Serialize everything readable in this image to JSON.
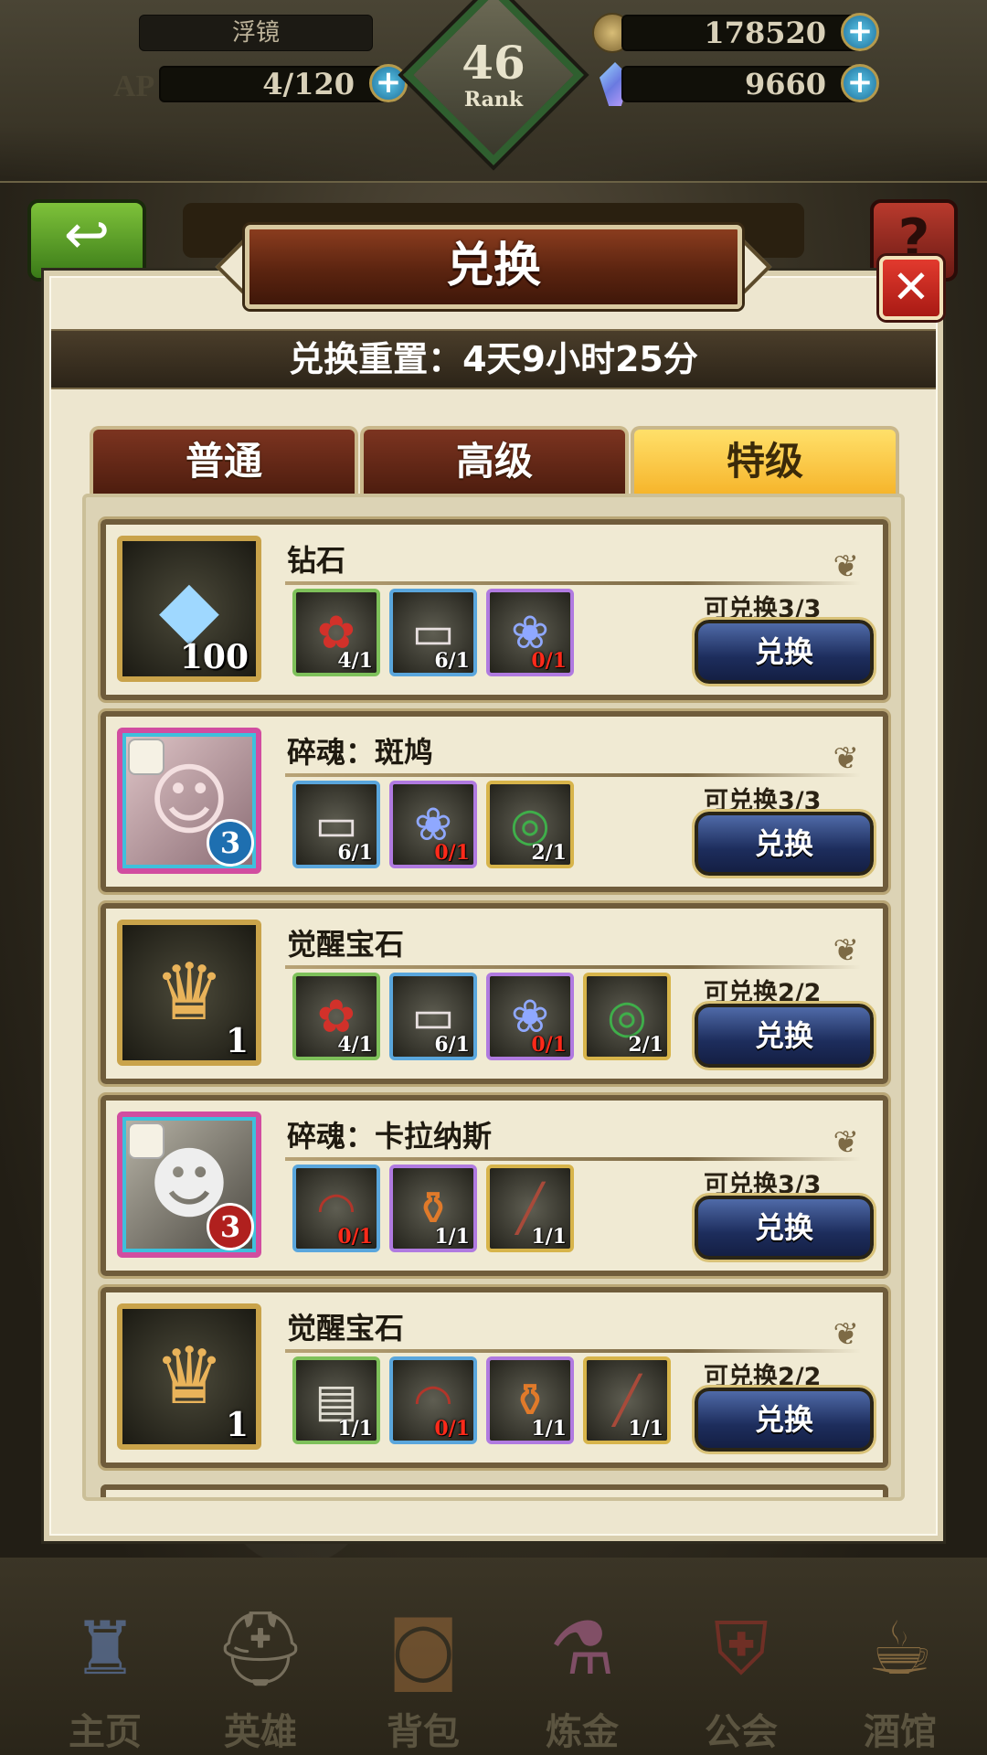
{
  "hud": {
    "player_name": "浮镜",
    "ap_label": "AP",
    "ap_value": "4/120",
    "rank_number": "46",
    "rank_label": "Rank",
    "gold": "178520",
    "gems": "9660",
    "plus_symbol": "+"
  },
  "dialog": {
    "title": "兑换",
    "close_symbol": "✕",
    "reset_text": "兑换重置：4天9小时25分",
    "tabs": [
      {
        "label": "普通",
        "active": false
      },
      {
        "label": "高级",
        "active": false
      },
      {
        "label": "特级",
        "active": true
      }
    ]
  },
  "rows": [
    {
      "name": "钻石",
      "reward_icon": "diamond-crystal-icon",
      "reward_qty": "100",
      "materials": [
        {
          "icon": "rose-bouquet-icon",
          "count": "4/1",
          "rarity": "green",
          "short": false
        },
        {
          "icon": "school-ticket-icon",
          "count": "6/1",
          "rarity": "blue",
          "short": false
        },
        {
          "icon": "blue-rose-icon",
          "count": "0/1",
          "rarity": "purple",
          "short": true
        }
      ],
      "available": "可兑换3/3",
      "button": "兑换"
    },
    {
      "name": "碎魂：斑鸠",
      "reward_icon": "hero-portrait-banjiu",
      "reward_badge": "3",
      "materials": [
        {
          "icon": "school-ticket-icon",
          "count": "6/1",
          "rarity": "blue",
          "short": false
        },
        {
          "icon": "blue-rose-icon",
          "count": "0/1",
          "rarity": "purple",
          "short": true
        },
        {
          "icon": "green-goggles-icon",
          "count": "2/1",
          "rarity": "gold",
          "short": false
        }
      ],
      "available": "可兑换3/3",
      "button": "兑换"
    },
    {
      "name": "觉醒宝石",
      "reward_icon": "awakening-gem-icon",
      "reward_qty": "1",
      "materials": [
        {
          "icon": "rose-bouquet-icon",
          "count": "4/1",
          "rarity": "green",
          "short": false
        },
        {
          "icon": "school-ticket-icon",
          "count": "6/1",
          "rarity": "blue",
          "short": false
        },
        {
          "icon": "blue-rose-icon",
          "count": "0/1",
          "rarity": "purple",
          "short": true
        },
        {
          "icon": "green-goggles-icon",
          "count": "2/1",
          "rarity": "gold",
          "short": false
        }
      ],
      "available": "可兑换2/2",
      "button": "兑换"
    },
    {
      "name": "碎魂：卡拉纳斯",
      "reward_icon": "hero-portrait-kalanasi",
      "reward_badge": "3",
      "materials": [
        {
          "icon": "red-mask-icon",
          "count": "0/1",
          "rarity": "blue",
          "short": true
        },
        {
          "icon": "potion-bottle-icon",
          "count": "1/1",
          "rarity": "purple",
          "short": false
        },
        {
          "icon": "flintlock-gun-icon",
          "count": "1/1",
          "rarity": "gold",
          "short": false
        }
      ],
      "available": "可兑换3/3",
      "button": "兑换"
    },
    {
      "name": "觉醒宝石",
      "reward_icon": "awakening-gem-icon",
      "reward_qty": "1",
      "materials": [
        {
          "icon": "newspaper-icon",
          "count": "1/1",
          "rarity": "green",
          "short": false
        },
        {
          "icon": "red-mask-icon",
          "count": "0/1",
          "rarity": "blue",
          "short": true
        },
        {
          "icon": "potion-bottle-icon",
          "count": "1/1",
          "rarity": "purple",
          "short": false
        },
        {
          "icon": "flintlock-gun-icon",
          "count": "1/1",
          "rarity": "gold",
          "short": false
        }
      ],
      "available": "可兑换2/2",
      "button": "兑换"
    }
  ],
  "nav": [
    {
      "label": "主页",
      "icon": "castle-icon"
    },
    {
      "label": "英雄",
      "icon": "knight-helmet-icon"
    },
    {
      "label": "背包",
      "icon": "backpack-icon"
    },
    {
      "label": "炼金",
      "icon": "flask-icon"
    },
    {
      "label": "公会",
      "icon": "guild-crest-icon"
    },
    {
      "label": "酒馆",
      "icon": "tavern-mug-icon"
    }
  ],
  "colors": {
    "panel_bg": "#ede6cf",
    "tab_active": "#f6b42a",
    "tab_inactive": "#7c3420",
    "exchange_button": "#1d2d5c",
    "shortage_text": "#ff2a1a"
  }
}
